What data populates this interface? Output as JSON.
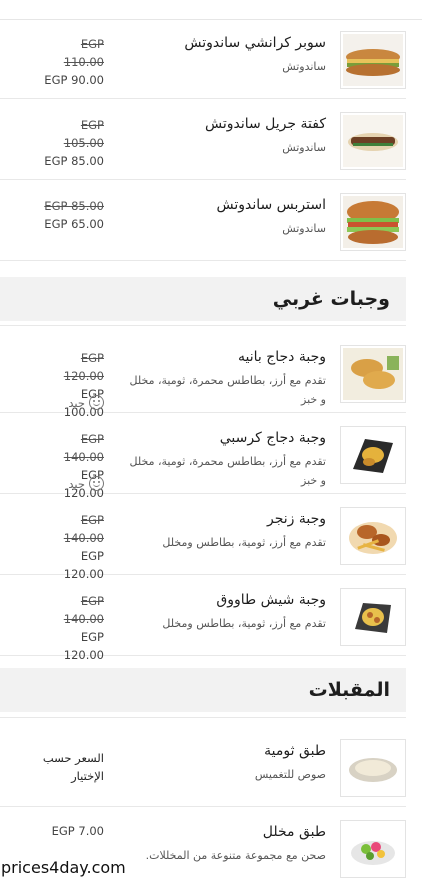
{
  "menu": {
    "items_top": [
      {
        "name": "سوبر كرانشي ساندوتش",
        "desc": "ساندوتش",
        "old_price": "EGP 110.00",
        "price": "EGP 90.00",
        "icon": "sandwich-sub"
      },
      {
        "name": "كفتة جريل ساندوتش",
        "desc": "ساندوتش",
        "old_price": "EGP 105.00",
        "price": "EGP 85.00",
        "icon": "sandwich-kofta"
      },
      {
        "name": "استربس ساندوتش",
        "desc": "ساندوتش",
        "old_price": "EGP 85.00",
        "price": "EGP 65.00",
        "icon": "sandwich-burger"
      }
    ],
    "sections": [
      {
        "title": "وجبات غربي"
      },
      {
        "title": "المقبلات"
      }
    ],
    "items_western": [
      {
        "name": "وجبة دجاج بانيه",
        "desc": "تقدم مع أرز، بطاطس محمرة، ثومية، مخلل و خبز",
        "old_price": "EGP 120.00",
        "price": "EGP 100.00",
        "rating": "جيد",
        "icon": "panne-meal"
      },
      {
        "name": "وجبة دجاج كرسبي",
        "desc": "تقدم مع أرز، بطاطس محمرة، ثومية، مخلل و خبز",
        "old_price": "EGP 140.00",
        "price": "EGP 120.00",
        "rating": "جيد",
        "icon": "crispy-meal"
      },
      {
        "name": "وجبة زنجر",
        "desc": "تقدم مع أرز، ثومية، بطاطس ومخلل",
        "old_price": "EGP 140.00",
        "price": "EGP 120.00",
        "icon": "zinger-meal"
      },
      {
        "name": "وجبة شيش طاووق",
        "desc": "تقدم مع أرز، ثومية، بطاطس ومخلل",
        "old_price": "EGP 140.00",
        "price": "EGP 120.00",
        "icon": "shish-meal"
      }
    ],
    "items_appetizers": [
      {
        "name": "طبق ثومية",
        "desc": "صوص للتغميس",
        "price_note": "السعر حسب الإختيار",
        "icon": "garlic-dip"
      },
      {
        "name": "طبق مخلل",
        "desc": "صحن مع مجموعة متنوعة من المخللات.",
        "price": "EGP 7.00",
        "icon": "pickles-plate"
      }
    ]
  },
  "watermark": "prices4day.com"
}
